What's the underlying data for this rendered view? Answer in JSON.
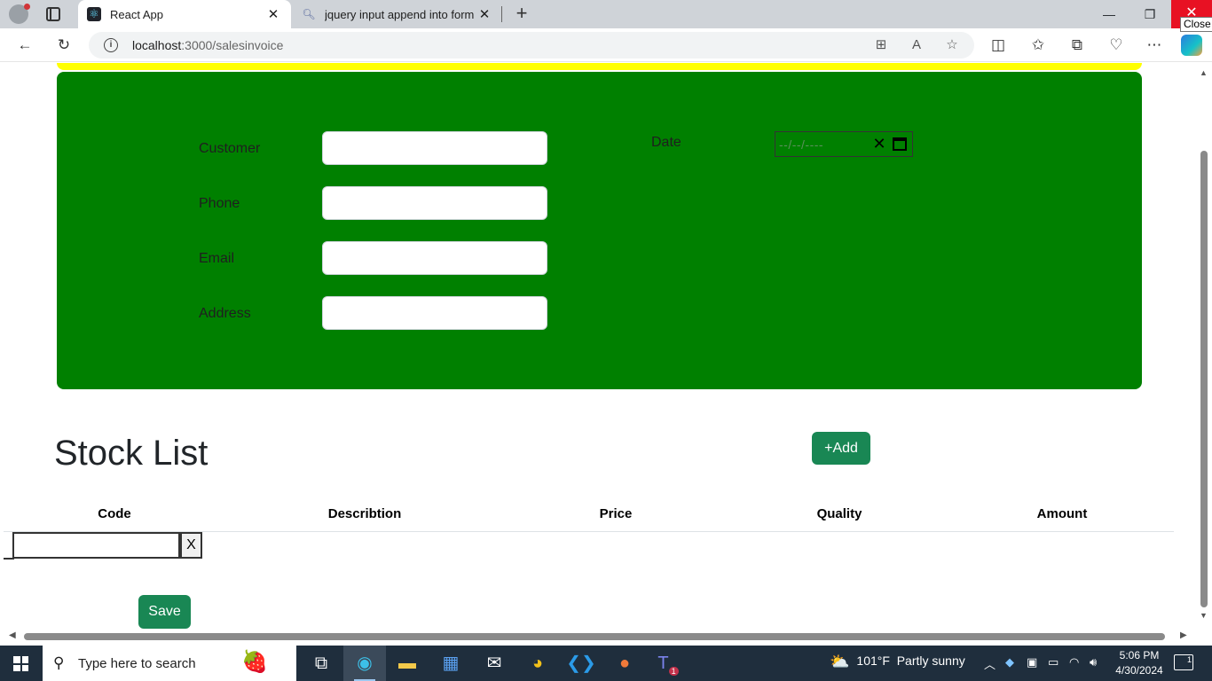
{
  "browser": {
    "tabs": [
      {
        "title": "React App",
        "favicon": "react-icon",
        "active": true
      },
      {
        "title": "jquery input append into form - S",
        "favicon": "search-icon",
        "active": false
      }
    ],
    "close_tooltip": "Close",
    "address": {
      "host": "localhost",
      "path": ":3000/salesinvoice"
    }
  },
  "form": {
    "labels": {
      "customer": "Customer",
      "phone": "Phone",
      "email": "Email",
      "address": "Address",
      "date": "Date"
    },
    "values": {
      "customer": "",
      "phone": "",
      "email": "",
      "address": ""
    },
    "date_placeholder": "--/--/----",
    "colors": {
      "panel": "#008000",
      "strip": "#ffff00"
    }
  },
  "stock": {
    "title": "Stock List",
    "add_label": "+Add",
    "columns": [
      "Code",
      "Describtion",
      "Price",
      "Quality",
      "Amount"
    ],
    "rows": [
      {
        "code": "",
        "remove_label": "X"
      }
    ],
    "save_label": "Save",
    "button_color": "#198754"
  },
  "taskbar": {
    "search_placeholder": "Type here to search",
    "weather": {
      "temp": "101°F",
      "condition": "Partly sunny"
    },
    "time": "5:06 PM",
    "date": "4/30/2024",
    "notification_count": "1",
    "teams_badge": "1"
  }
}
